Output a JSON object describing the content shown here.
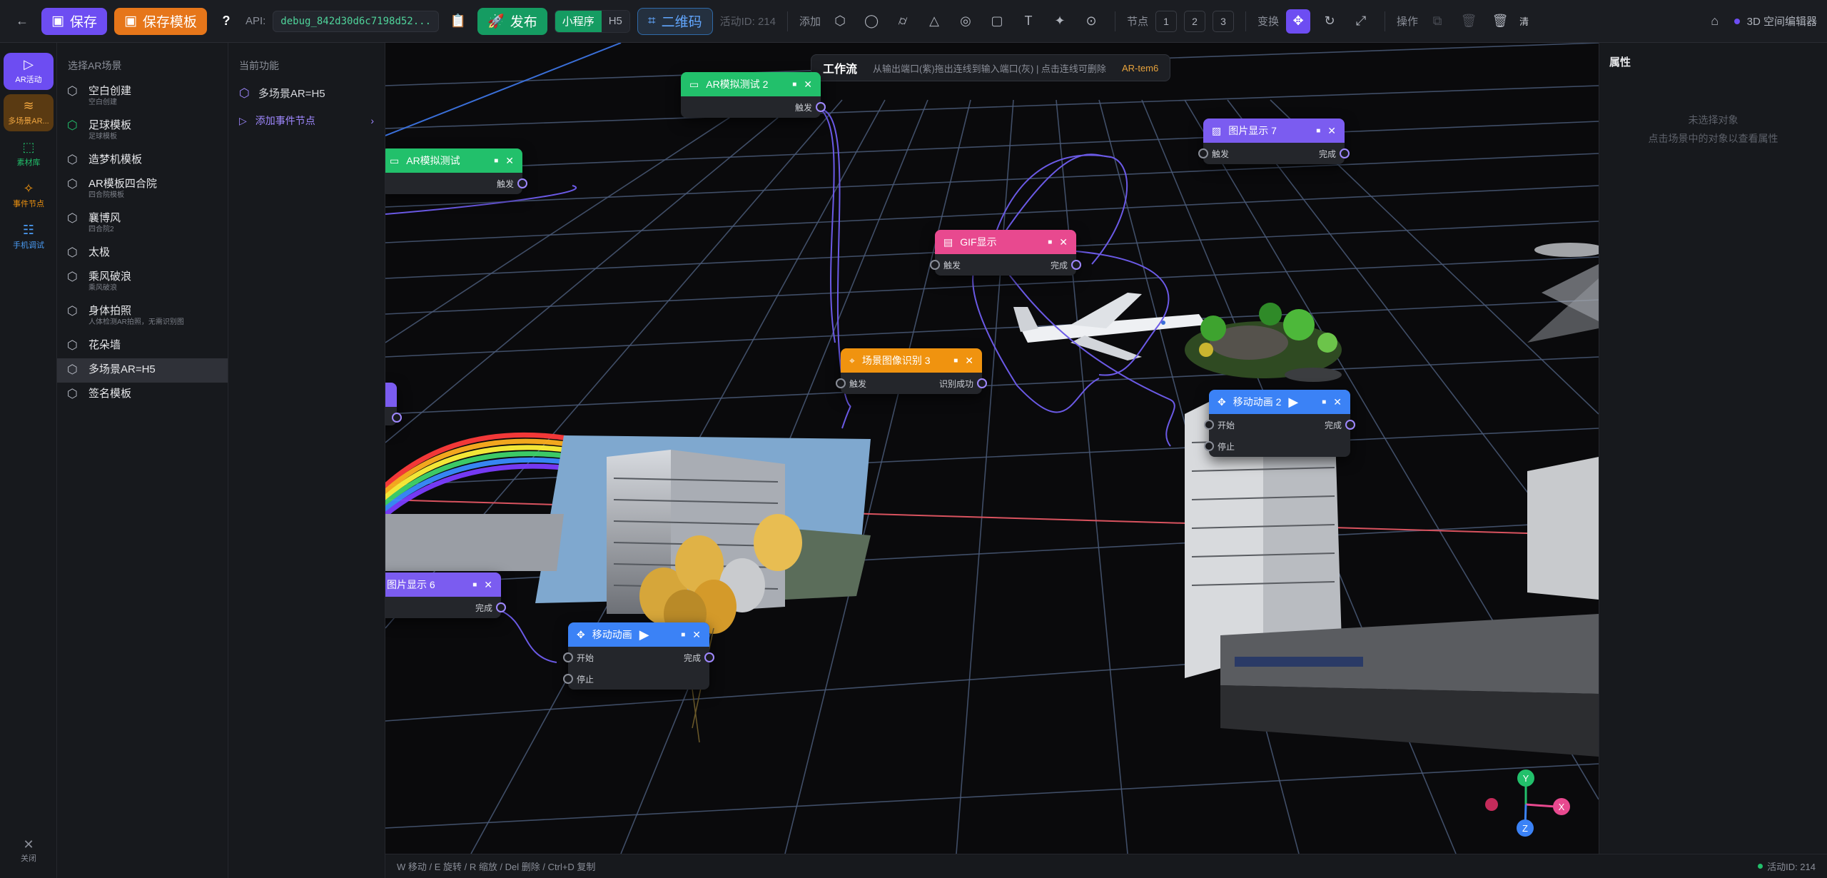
{
  "topbar": {
    "save": "保存",
    "save_template": "保存模板",
    "help": "?",
    "api_label": "API:",
    "api_value": "debug_842d30d6c7198d52...",
    "publish": "发布",
    "mode_miniprogram": "小程序",
    "mode_h5": "H5",
    "qrcode": "二维码",
    "activity_id": "活动ID: 214",
    "add_label": "添加",
    "node_label": "节点",
    "node_nums": [
      "1",
      "2",
      "3"
    ],
    "transform_label": "变换",
    "ops_label": "操作",
    "ops_clear": "清",
    "editor_title": "3D 空间编辑器"
  },
  "rail": [
    {
      "label": "AR活动",
      "icon": "play-icon"
    },
    {
      "label": "多场景AR...",
      "icon": "layers-icon"
    },
    {
      "label": "素材库",
      "icon": "box-icon"
    },
    {
      "label": "事件节点",
      "icon": "sparkle-icon"
    },
    {
      "label": "手机调试",
      "icon": "sliders-icon"
    }
  ],
  "rail_close": "关闭",
  "scenes": {
    "header": "选择AR场景",
    "items": [
      {
        "title": "空白创建",
        "sub": "空白创建"
      },
      {
        "title": "足球模板",
        "sub": "足球模板"
      },
      {
        "title": "造梦机模板",
        "sub": ""
      },
      {
        "title": "AR模板四合院",
        "sub": "四合院模板"
      },
      {
        "title": "襄博风",
        "sub": "四合院2"
      },
      {
        "title": "太极",
        "sub": ""
      },
      {
        "title": "乘风破浪",
        "sub": "乘风破浪"
      },
      {
        "title": "身体拍照",
        "sub": "人体检测AR拍照，无需识别图"
      },
      {
        "title": "花朵墙",
        "sub": ""
      },
      {
        "title": "多场景AR=H5",
        "sub": ""
      },
      {
        "title": "签名模板",
        "sub": ""
      }
    ]
  },
  "feature": {
    "header": "当前功能",
    "current": "多场景AR=H5",
    "add_event": "添加事件节点"
  },
  "hint": {
    "title": "工作流",
    "text": "从输出端口(紫)拖出连线到输入端口(灰) | 点击连线可删除",
    "tag": "AR-tem6"
  },
  "nodes": {
    "ar_test2": {
      "title": "AR模拟测试 2",
      "out": "触发"
    },
    "ar_test": {
      "title": "AR模拟测试",
      "out": "触发"
    },
    "img7": {
      "title": "图片显示 7",
      "in": "触发",
      "out": "完成"
    },
    "gif": {
      "title": "GIF显示",
      "in": "触发",
      "out": "完成"
    },
    "recog3": {
      "title": "场景图像识别 3",
      "in": "触发",
      "out": "识别成功"
    },
    "move2": {
      "title": "移动动画 2",
      "in": "开始",
      "in2": "停止",
      "out": "完成"
    },
    "img6": {
      "title": "图片显示 6",
      "out": "完成"
    },
    "move": {
      "title": "移动动画",
      "in": "开始",
      "in2": "停止",
      "out": "完成"
    }
  },
  "axes": {
    "x": "X",
    "y": "Y",
    "z": "Z"
  },
  "props": {
    "header": "属性",
    "empty1": "未选择对象",
    "empty2": "点击场景中的对象以查看属性"
  },
  "status": {
    "shortcuts": "W 移动 / E 旋转 / R 缩放 / Del 删除 / Ctrl+D 复制",
    "activity": "活动ID: 214"
  },
  "colors": {
    "accent": "#6d4df2",
    "green": "#22c06b",
    "pink": "#e8498f",
    "orange": "#f0930f",
    "blue": "#3b82f6",
    "purple": "#7b5cf0"
  }
}
